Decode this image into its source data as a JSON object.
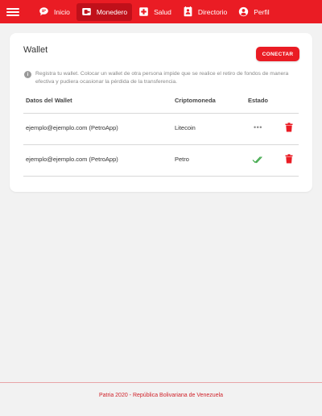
{
  "theme": {
    "brand_red": "#ea1c24",
    "active_red": "#c0101a",
    "check_green": "#3aa645"
  },
  "navbar": {
    "menu_icon": "hamburger-icon",
    "items": [
      {
        "label": "Inicio",
        "icon": "chat-icon",
        "active": false
      },
      {
        "label": "Monedero",
        "icon": "wallet-icon",
        "active": true
      },
      {
        "label": "Salud",
        "icon": "medical-cross-icon",
        "active": false
      },
      {
        "label": "Directorio",
        "icon": "contacts-icon",
        "active": false
      },
      {
        "label": "Perfil",
        "icon": "user-icon",
        "active": false
      }
    ]
  },
  "wallet": {
    "title": "Wallet",
    "connect_label": "CONECTAR",
    "info_icon": "info-icon",
    "info_text": "Registra tu wallet. Colocar un wallet de otra persona impide que se realice el retiro de fondos de manera efectiva y pudiera ocasionar la pérdida de la transferencia.",
    "columns": [
      "Datos del Wallet",
      "Criptomoneda",
      "Estado"
    ],
    "rows": [
      {
        "wallet": "ejemplo@ejemplo.com (PetroApp)",
        "crypto": "Litecoin",
        "status": "pending",
        "status_icon": "more-dots-icon",
        "delete_icon": "trash-icon"
      },
      {
        "wallet": "ejemplo@ejemplo.com (PetroApp)",
        "crypto": "Petro",
        "status": "verified",
        "status_icon": "double-check-icon",
        "delete_icon": "trash-icon"
      }
    ]
  },
  "footer": {
    "text": "Patria 2020 - República Bolivariana de Venezuela"
  }
}
